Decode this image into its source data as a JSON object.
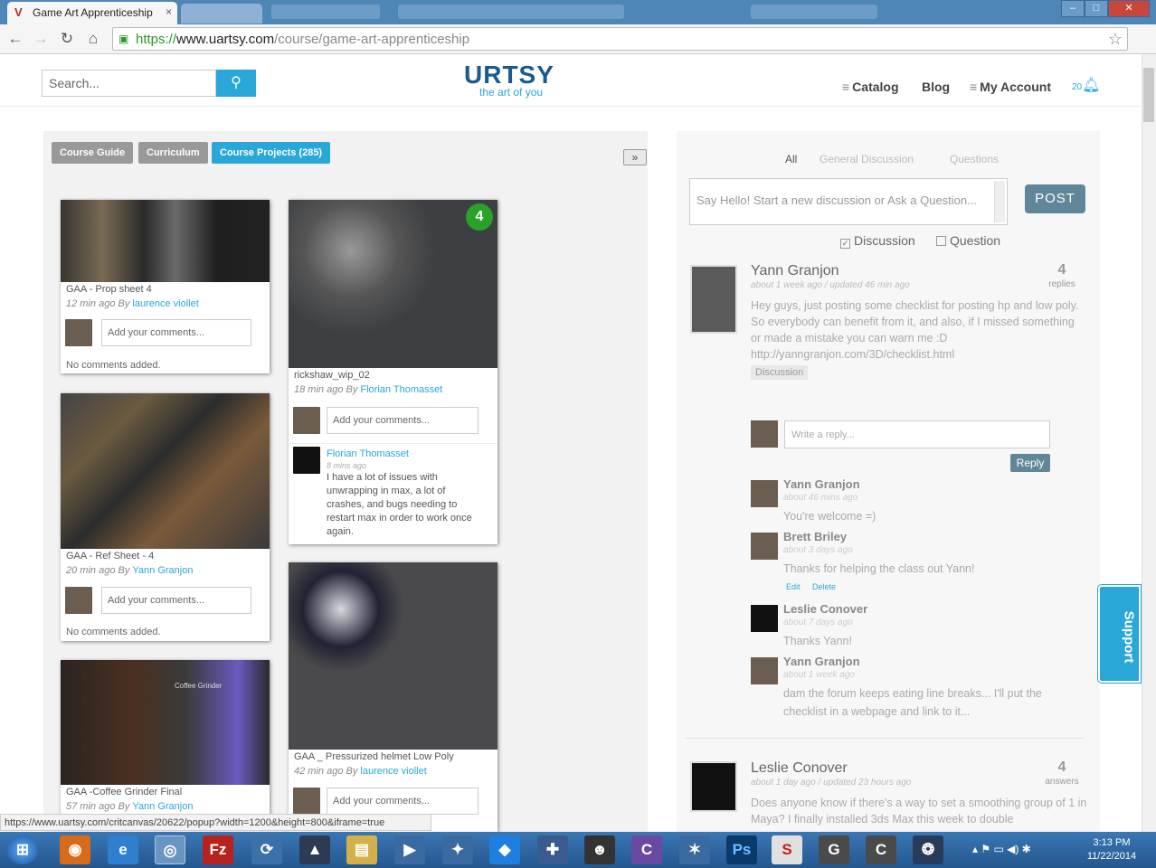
{
  "browser": {
    "tab_title": "Game Art Apprenticeship",
    "tab_close": "×",
    "url_scheme": "https://",
    "url_domain": "www.uartsy.com",
    "url_path": "/course/game-art-apprenticeship",
    "status_url": "https://www.uartsy.com/critcanvas/20622/popup?width=1200&height=800&iframe=true"
  },
  "header": {
    "search_placeholder": "Search...",
    "logo_main": "URTSY",
    "logo_tagline": "the art of you",
    "nav": {
      "catalog": "Catalog",
      "blog": "Blog",
      "account": "My Account"
    },
    "notification_count": "20"
  },
  "left": {
    "tabs": [
      "Course Guide",
      "Curriculum",
      "Course Projects (285)"
    ],
    "projects": [
      {
        "title": "GAA - Prop sheet 4",
        "time": "12 min",
        "ago_by": " ago By ",
        "author": "laurence viollet",
        "comment_placeholder": "Add your comments...",
        "no_comments": "No comments added."
      },
      {
        "title": "GAA - Ref Sheet - 4",
        "time": "20 min",
        "ago_by": " ago By ",
        "author": "Yann Granjon",
        "comment_placeholder": "Add your comments...",
        "no_comments": "No comments added."
      },
      {
        "title": "GAA -Coffee Grinder Final",
        "time": "57 min",
        "ago_by": " ago By ",
        "author": "Yann Granjon",
        "thumb_text": "Coffee Grinder"
      },
      {
        "title": "rickshaw_wip_02",
        "time": "18 min",
        "ago_by": " ago By ",
        "author": "Florian Thomasset",
        "badge": "4",
        "comment_placeholder": "Add your comments...",
        "comment_author": "Florian Thomasset",
        "comment_time": "8 mins ago",
        "comment_text": "I have a lot of issues with unwrapping in max, a lot of crashes, and bugs needing to restart max in order to work once again."
      },
      {
        "title": "GAA _ Pressurized helmet Low Poly",
        "time": "42 min",
        "ago_by": " ago By ",
        "author": "laurence viollet",
        "comment_placeholder": "Add your comments..."
      }
    ]
  },
  "right": {
    "filters": [
      "All",
      "General Discussion",
      "Questions"
    ],
    "post_placeholder": "Say Hello! Start a new discussion or Ask a Question...",
    "post_button": "POST",
    "checkboxes": [
      {
        "label": "Discussion",
        "checked": true
      },
      {
        "label": "Question",
        "checked": false
      }
    ],
    "posts": [
      {
        "author": "Yann Granjon",
        "meta": "about 1 week ago / updated 46 min ago",
        "count": "4",
        "count_label": "replies",
        "body": "Hey guys, just posting some checklist for posting hp and low poly. So everybody can benefit from it, and also, if I missed something or made a mistake you can warn me :D http://yanngranjon.com/3D/checklist.html",
        "tag": "Discussion"
      },
      {
        "author": "Leslie Conover",
        "meta": "about 1 day ago / updated 23 hours ago",
        "count": "4",
        "count_label": "answers",
        "body": "Does anyone know if there's a way to set a smoothing group of 1 in Maya? I finally installed 3ds Max this week to double"
      }
    ],
    "reply_placeholder": "Write a reply...",
    "reply_button": "Reply",
    "replies": [
      {
        "name": "Yann Granjon",
        "meta": "about 46 mins ago",
        "text": "You're welcome =)"
      },
      {
        "name": "Brett Briley",
        "meta": "about 3 days ago",
        "text": "Thanks for helping the class out Yann!",
        "edit": "Edit",
        "delete": "Delete"
      },
      {
        "name": "Leslie Conover",
        "meta": "about 7 days ago",
        "text": "Thanks Yann!"
      },
      {
        "name": "Yann Granjon",
        "meta": "about 1 week ago",
        "text": "dam the forum keeps eating line breaks... I'll put the checklist in a webpage and link to it..."
      }
    ]
  },
  "support_label": "Support",
  "taskbar": {
    "time": "3:13 PM",
    "date": "11/22/2014"
  }
}
